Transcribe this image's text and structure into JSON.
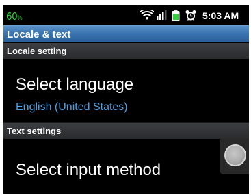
{
  "status_bar": {
    "battery_level": "60",
    "battery_unit": "%",
    "time": "5:03 AM",
    "icons": [
      "wifi-icon",
      "signal-bars-icon",
      "battery-icon",
      "alarm-clock-icon"
    ]
  },
  "header": {
    "title": "Locale & text"
  },
  "sections": {
    "locale": {
      "header": "Locale setting",
      "item_title": "Select language",
      "item_summary": "English (United States)"
    },
    "text": {
      "header": "Text settings",
      "item_title": "Select input method"
    }
  },
  "colors": {
    "battery_text": "#2fd43a",
    "title_bar": "#3a74b0",
    "summary_text": "#4b9fe3",
    "background": "#000000"
  }
}
